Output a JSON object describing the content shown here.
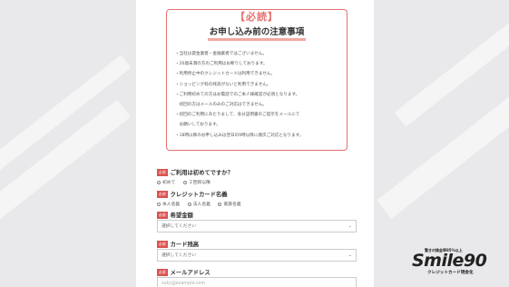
{
  "notice": {
    "badge": "【必読】",
    "title": "お申し込み前の注意事項",
    "lines": [
      "・当社は貸金業者・金融業者ではございません。",
      "・20歳未満の方のご利用はお断りしております。",
      "・利用停止中のクレジットカードは利用できません。",
      "・ショッピング枠の残高がないと利用できません。",
      "・ご利用初めての方はお電話でのご本人様確認が必須となります。",
      "　初回の方はメールのみのご対応はできません。",
      "・初回のご利用にあたりまして、身分証明書のご提示をメールにて",
      "　お願いしております。",
      "・18時以降のお申し込みは翌日の9時以降に順次ご対応となります。"
    ]
  },
  "form": {
    "required_label": "必須",
    "q1": {
      "label": "ご利用は初めてですか？",
      "options": [
        "初めて",
        "２回目以降"
      ]
    },
    "q2": {
      "label": "クレジットカード名義",
      "options": [
        "本人名義",
        "法人名義",
        "家族名義"
      ]
    },
    "q3": {
      "label": "希望金額",
      "placeholder": "選択してください"
    },
    "q4": {
      "label": "カード残高",
      "placeholder": "選択してください"
    },
    "q5": {
      "label": "メールアドレス",
      "placeholder": "sukc@example.com"
    }
  },
  "logo": {
    "tagline": "驚きの換金率85%以上",
    "name": "Smile90",
    "sub": "クレジットカード現金化"
  },
  "colors": {
    "accent": "#e4716f",
    "required_bg": "#d9534f",
    "highlight": "#f2a7a3"
  }
}
